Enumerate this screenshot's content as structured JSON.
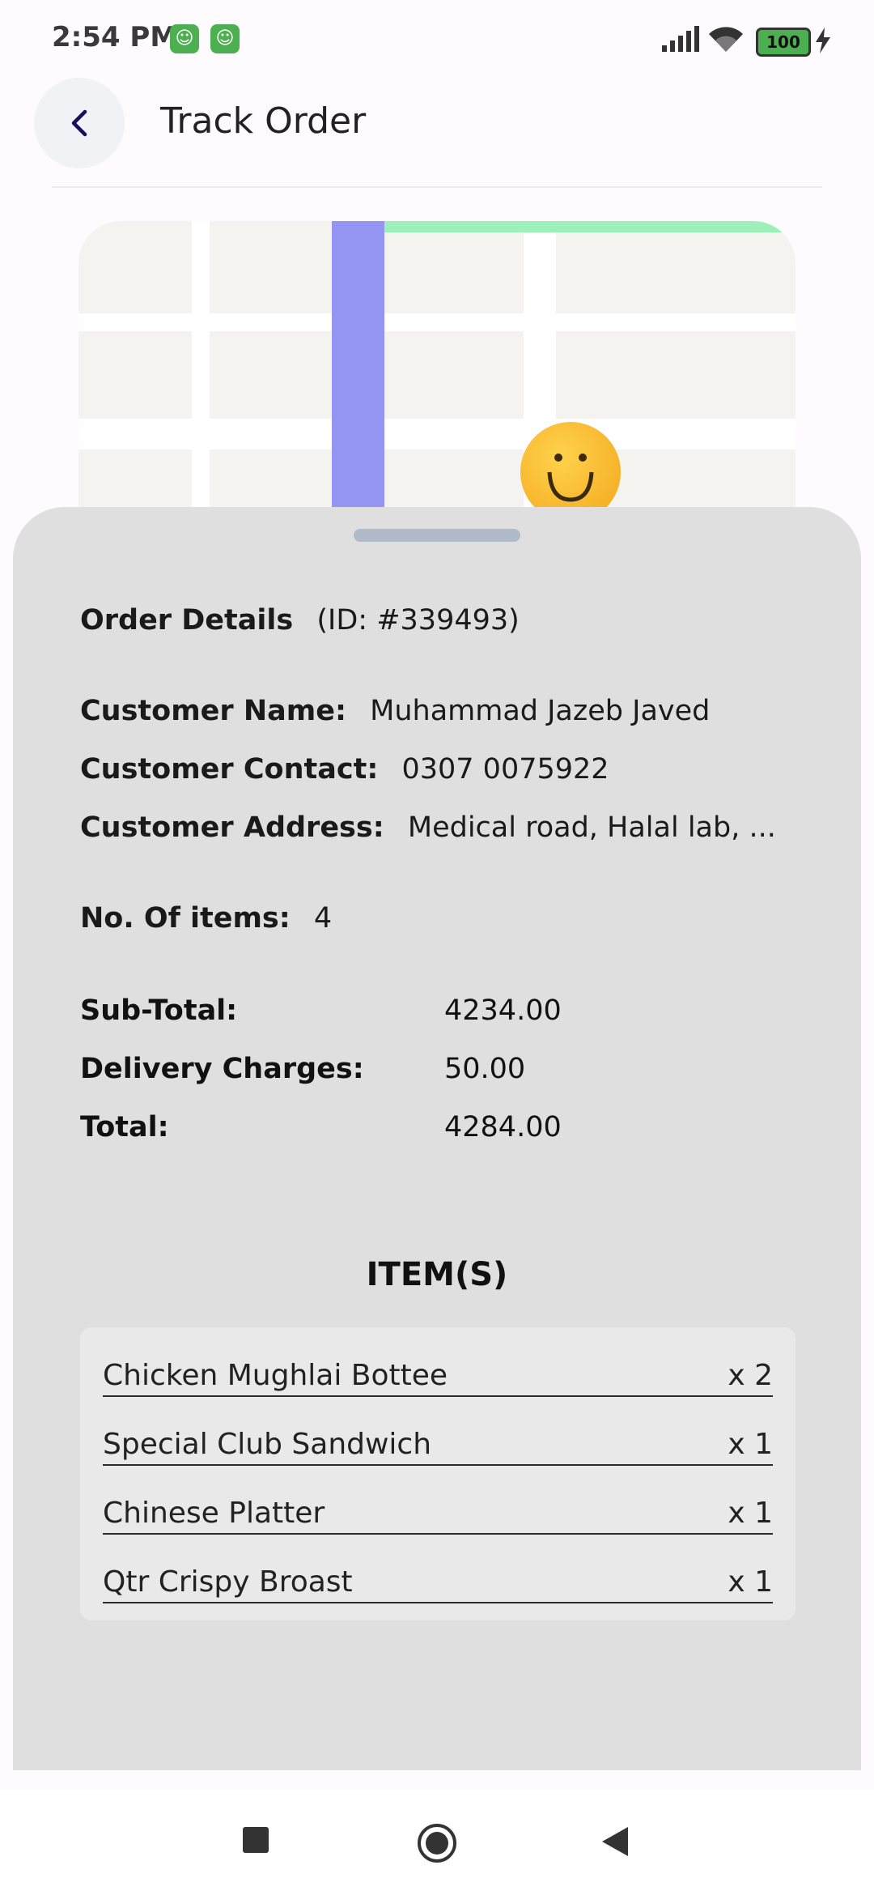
{
  "status_bar": {
    "time": "2:54 PM",
    "battery": "100"
  },
  "header": {
    "title": "Track Order"
  },
  "order": {
    "details_label": "Order Details",
    "id_text": "(ID: #339493)",
    "customer_name_label": "Customer Name:",
    "customer_name": "Muhammad Jazeb Javed",
    "customer_contact_label": "Customer Contact:",
    "customer_contact": "0307 0075922",
    "customer_address_label": "Customer Address:",
    "customer_address": "Medical road, Halal lab, ...",
    "items_count_label": "No. Of items:",
    "items_count": "4",
    "subtotal_label": "Sub-Total:",
    "subtotal": "4234.00",
    "delivery_label": "Delivery Charges:",
    "delivery": "50.00",
    "total_label": "Total:",
    "total": "4284.00"
  },
  "items_section": {
    "heading": "ITEM(S)",
    "items": [
      {
        "name": "Chicken Mughlai Bottee",
        "qty": "x 2"
      },
      {
        "name": "Special Club Sandwich",
        "qty": "x 1"
      },
      {
        "name": "Chinese Platter",
        "qty": "x 1"
      },
      {
        "name": "Qtr Crispy Broast",
        "qty": "x 1"
      }
    ]
  },
  "colors": {
    "accent": "#1a0f5c",
    "route_blue": "#9494f3",
    "route_green": "#9cf0b8",
    "marker": "#f3a61a",
    "app_badge": "#4caf50"
  },
  "icons": [
    "back-chevron-icon",
    "signal-icon",
    "wifi-icon",
    "battery-icon",
    "charging-icon",
    "smiley-marker-icon",
    "nav-recents-icon",
    "nav-home-icon",
    "nav-back-icon"
  ]
}
